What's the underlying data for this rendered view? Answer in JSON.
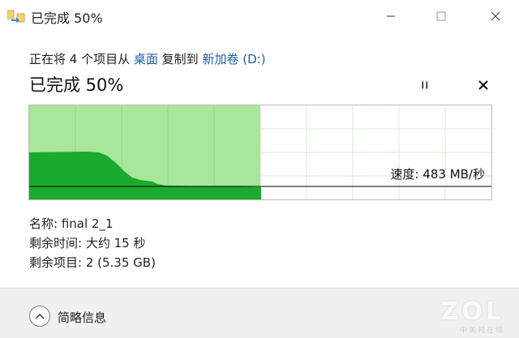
{
  "window": {
    "title": "已完成 50%",
    "icon": "copy-files-icon",
    "controls": [
      "minimize-icon",
      "maximize-icon",
      "close-icon"
    ]
  },
  "copy_status": {
    "prefix": "正在将 4 个项目从",
    "source": "桌面",
    "middle": "复制到",
    "destination": "新加卷 (D:)"
  },
  "progress": {
    "title": "已完成 50%",
    "percent": 50,
    "pause_icon": "pause-icon",
    "cancel_icon": "close-icon"
  },
  "graph": {
    "speed_label": "速度: 483 MB/秒",
    "completed_fraction": 0.5,
    "colors": {
      "completed_fill": "#a7e69b",
      "throughput_fill": "#1aab2e",
      "grid": "#c9e9c1",
      "speed_line": "#000000"
    }
  },
  "details": {
    "name": "名称: final 2_1",
    "time_remaining": "剩余时间: 大约 15 秒",
    "items_remaining": "剩余项目: 2 (5.35 GB)"
  },
  "footer": {
    "toggle_label": "简略信息",
    "toggle_icon": "chevron-up-icon"
  },
  "watermark": {
    "main": "ZOL",
    "sub": "中关村在线"
  }
}
